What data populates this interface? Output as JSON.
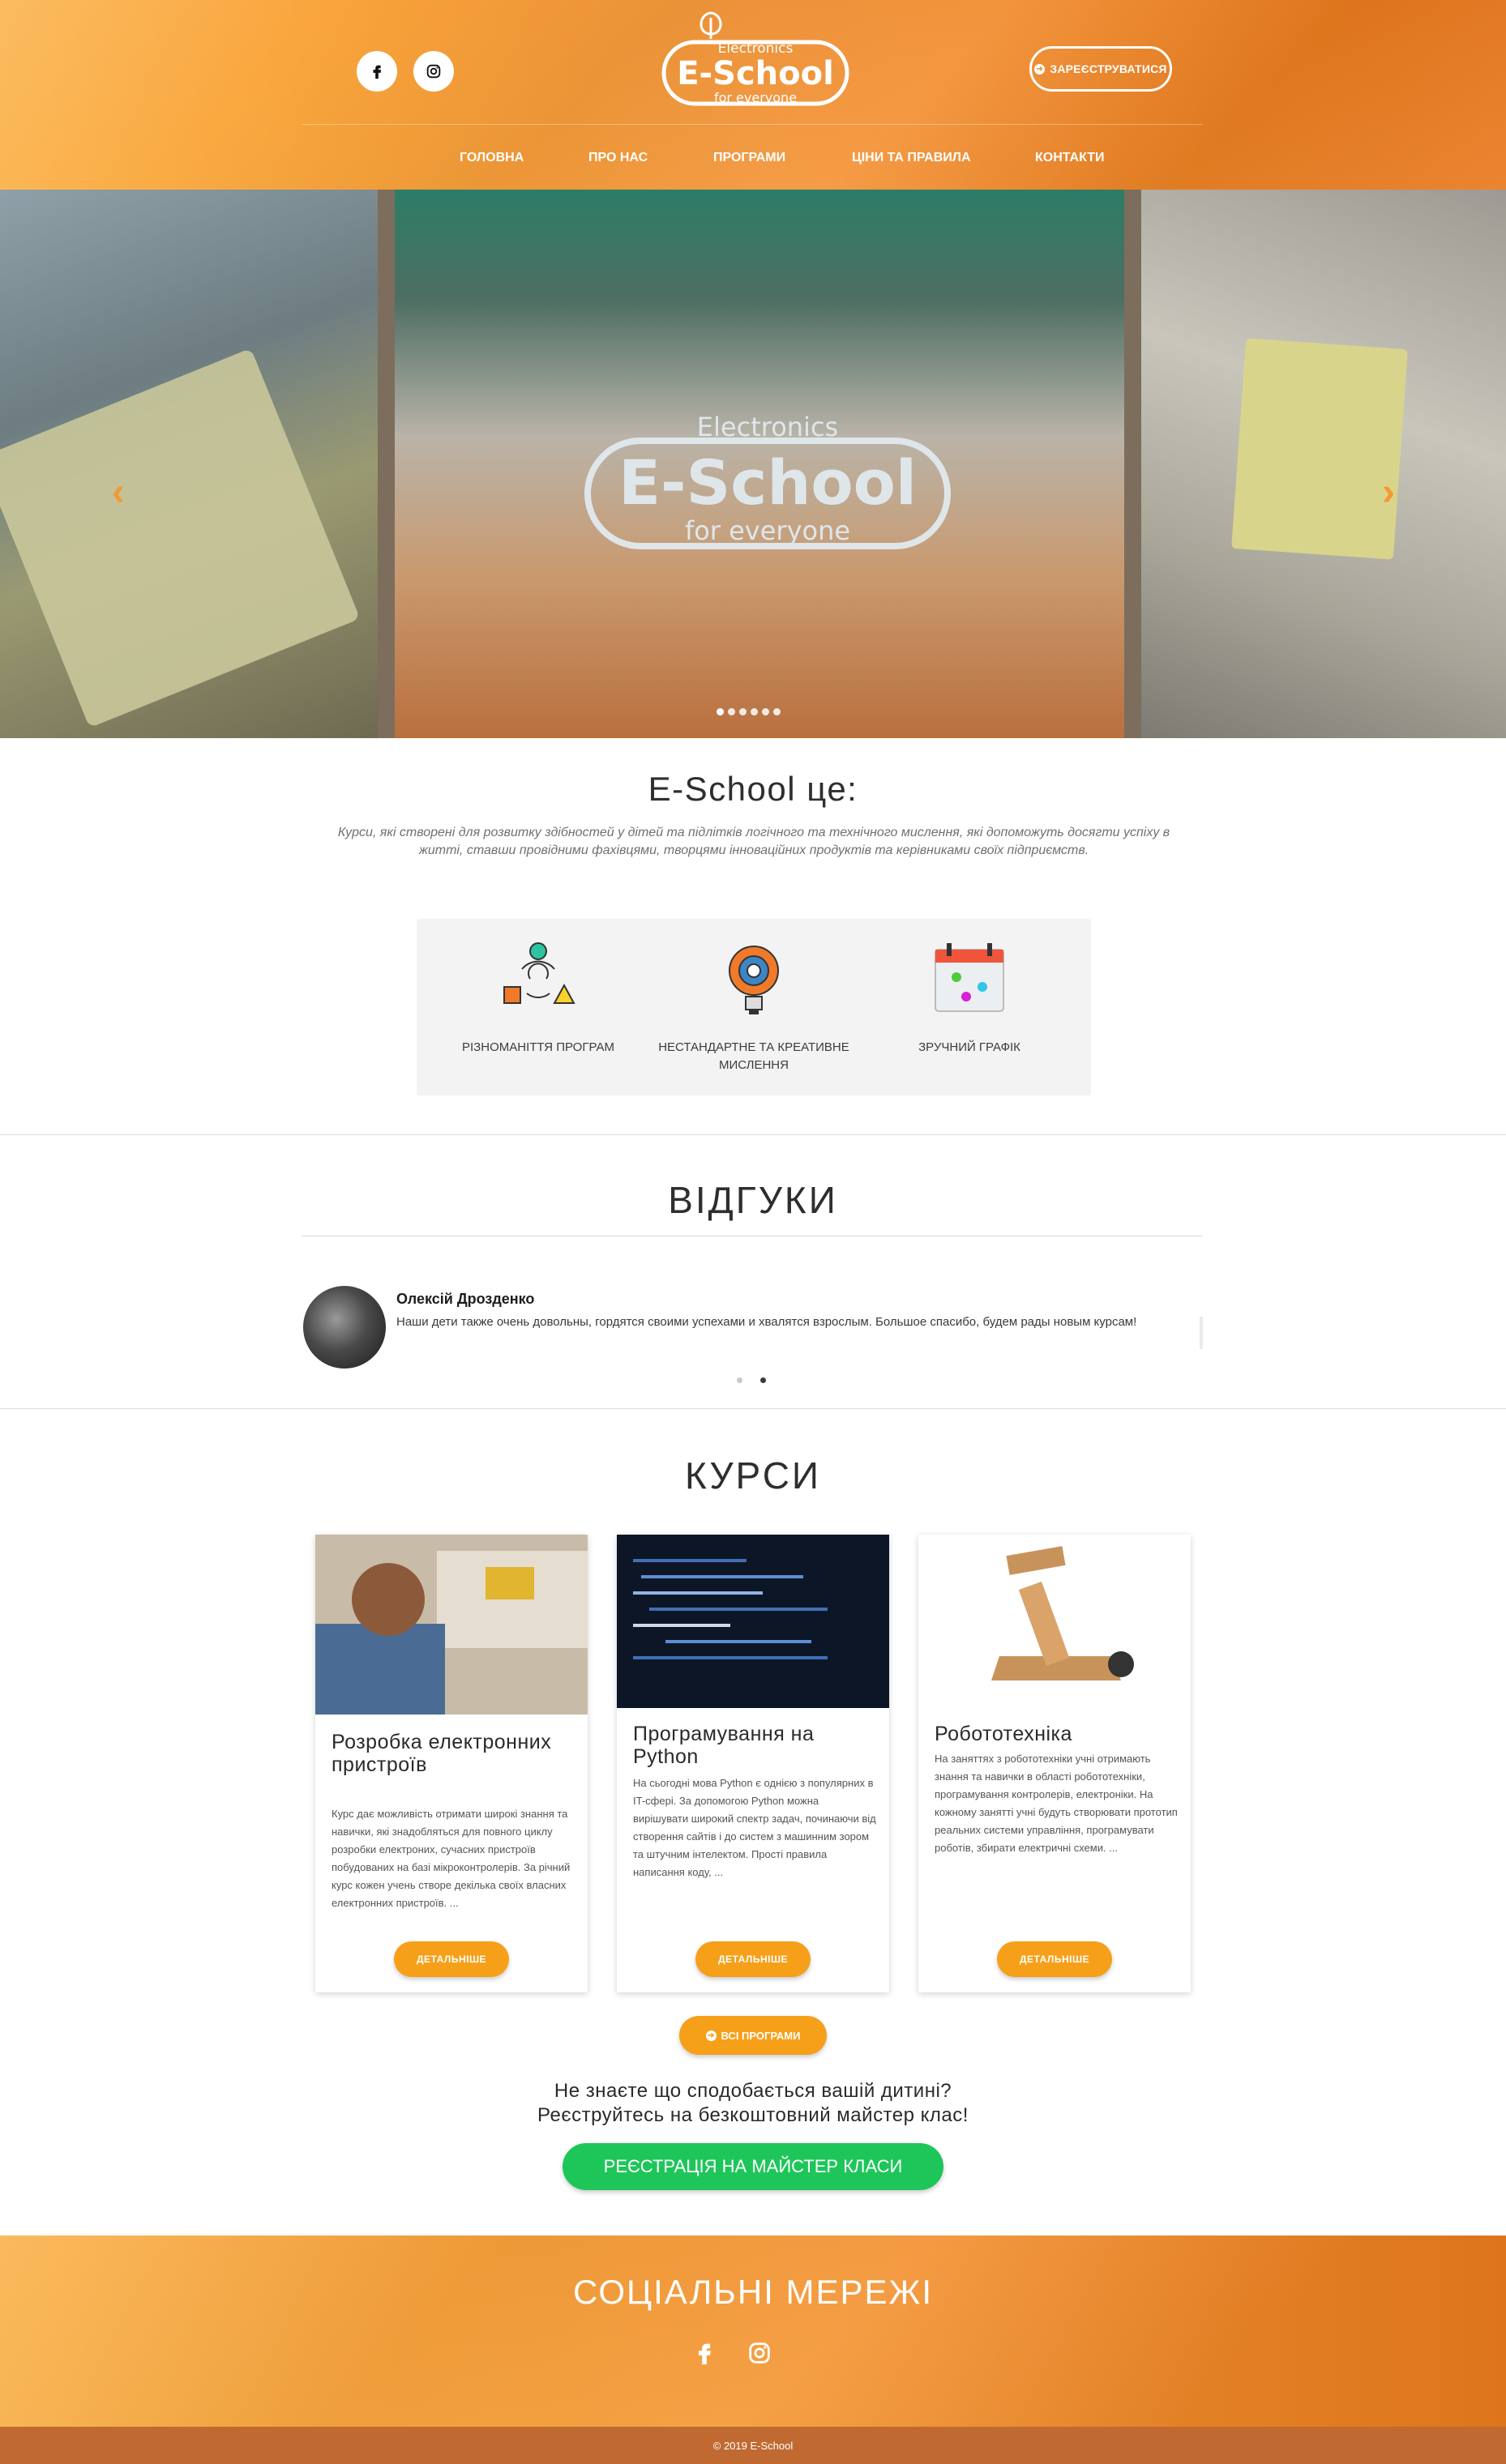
{
  "header": {
    "social": {
      "facebook_icon": "facebook-icon",
      "instagram_icon": "instagram-icon"
    },
    "logo": {
      "top": "Electronics",
      "main": "E-School",
      "bottom": "for everyone"
    },
    "register_label": "ЗАРЕЄСТРУВАТИСЯ",
    "nav": [
      "ГОЛОВНА",
      "ПРО НАС",
      "ПРОГРАМИ",
      "ЦІНИ ТА ПРАВИЛА",
      "КОНТАКТИ"
    ]
  },
  "hero": {
    "logo": {
      "top": "Electronics",
      "main": "E-School",
      "bottom": "for everyone"
    },
    "slides_count": 6,
    "active_slide": 1
  },
  "about": {
    "title": "E-School це:",
    "text": "Курси, які створені для розвитку здібностей у дітей та підлітків логічного та технічного мислення, які допоможуть досягти успіху в житті, ставши провідними фахівцями, творцями інноваційних продуктів та керівниками своїх підприємств.",
    "features": [
      {
        "label": "РІЗНОМАНІТТЯ ПРОГРАМ",
        "icon": "cycle-shapes-icon"
      },
      {
        "label": "НЕСТАНДАРТНЕ ТА КРЕАТИВНЕ МИСЛЕННЯ",
        "icon": "lightbulb-gear-icon"
      },
      {
        "label": "ЗРУЧНИЙ ГРАФІК",
        "icon": "calendar-icon"
      }
    ]
  },
  "reviews": {
    "title": "ВІДГУКИ",
    "items": [
      {
        "name": "Олексій Дрозденко",
        "text": "Наши дети также очень довольны, гордятся своими успехами и хвалятся взрослым. Большое спасибо, будем рады новым курсам!"
      }
    ]
  },
  "courses": {
    "title": "КУРСИ",
    "items": [
      {
        "title": "Розробка електронних пристроїв",
        "description": "Курс дає можливість отримати широкі знання та навички, які знадобляться для повного циклу розробки електроних, сучасних пристроїв побудованих на базі мікроконтролерів. За річний курс кожен учень створе декілька своїх власних електронних пристроїв. ...",
        "button": "ДЕТАЛЬНІШЕ"
      },
      {
        "title": "Програмування на Python",
        "description": "На сьогодні мова Python є однією з популярних в IT-сфері. За допомогою Python можна вирішувати широкий спектр задач, починаючи від створення сайтів і до систем з машинним зором та штучним інтелектом. Прості правила написання коду, ...",
        "button": "ДЕТАЛЬНІШЕ"
      },
      {
        "title": "Робототехніка",
        "description": "На заняттях з робототехніки учні отримають знання та навички в області робототехніки, програмування контролерів, електроніки. На кожному занятті учні будуть створювати прототип реальних системи управління, програмувати роботів, збирати електричні схеми. ...",
        "button": "ДЕТАЛЬНІШЕ"
      }
    ],
    "all_programs_label": "ВСІ ПРОГРАМИ"
  },
  "cta": {
    "line1": "Не знаєте що сподобається вашій дитині?",
    "line2": "Реєструйтесь на безкоштовний майстер клас!",
    "button": "РЕЄСТРАЦІЯ НА МАЙСТЕР КЛАСИ"
  },
  "footer": {
    "title": "СОЦІАЛЬНІ МЕРЕЖІ",
    "copyright": "© 2019 E-School"
  },
  "colors": {
    "accent": "#f6a01a",
    "cta": "#1ec65a",
    "header_start": "#fbb24a",
    "header_end": "#e9761a"
  }
}
